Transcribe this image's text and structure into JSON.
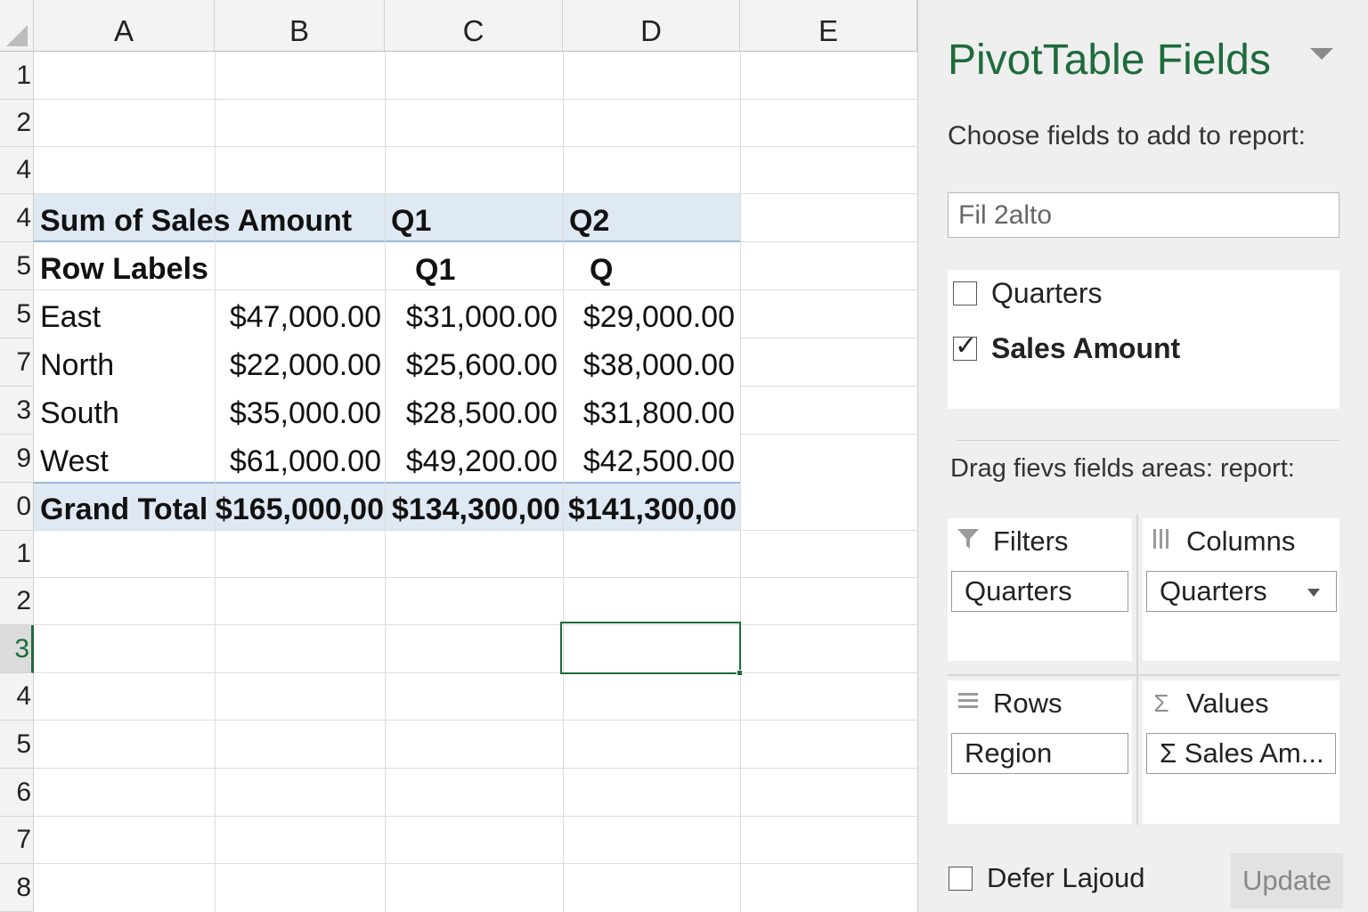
{
  "sheet": {
    "columns": [
      "A",
      "B",
      "C",
      "D",
      "E"
    ],
    "rows": [
      "1",
      "2",
      "4",
      "4",
      "5",
      "5",
      "7",
      "3",
      "9",
      "0",
      "1",
      "2",
      "3",
      "4",
      "5",
      "6",
      "7",
      "8"
    ],
    "active_row": "3",
    "pivot": {
      "header_title": "Sum of Sales Amount",
      "header_col1": "Q1",
      "header_col2": "Q2",
      "row_labels": "Row Labels",
      "sub_col1": "Q1",
      "sub_col2": "Q",
      "body": [
        {
          "label": "East",
          "b": "$47,000.00",
          "c": "$31,000.00",
          "d": "$29,000.00"
        },
        {
          "label": "North",
          "b": "$22,000.00",
          "c": "$25,600.00",
          "d": "$38,000.00"
        },
        {
          "label": "South",
          "b": "$35,000.00",
          "c": "$28,500.00",
          "d": "$31,800.00"
        },
        {
          "label": "West",
          "b": "$61,000.00",
          "c": "$49,200.00",
          "d": "$42,500.00"
        }
      ],
      "total": {
        "label": "Grand Total",
        "b": "$165,000,00",
        "c": "$134,300,00",
        "d": "$141,300,00"
      }
    }
  },
  "pane": {
    "title": "PivotTable Fields",
    "choose_label": "Choose fields to add to report:",
    "search_value": "Fil 2alto",
    "fields": [
      {
        "label": "Quarters",
        "checked": false
      },
      {
        "label": "Sales Amount",
        "checked": true
      }
    ],
    "drag_label": "Drag fievs fields areas: report:",
    "areas": {
      "filters": {
        "title": "Filters",
        "item": "Quarters"
      },
      "columns": {
        "title": "Columns",
        "item": "Quarters"
      },
      "rows": {
        "title": "Rows",
        "item": "Region"
      },
      "values": {
        "title": "Values",
        "item": "Σ Sales Am..."
      }
    },
    "defer_label": "Defer Lajoud",
    "update_label": "Update"
  },
  "colors": {
    "accent_green": "#1e6b3b",
    "pivot_band": "#dfe9f3",
    "selection": "#1d6b3a"
  }
}
